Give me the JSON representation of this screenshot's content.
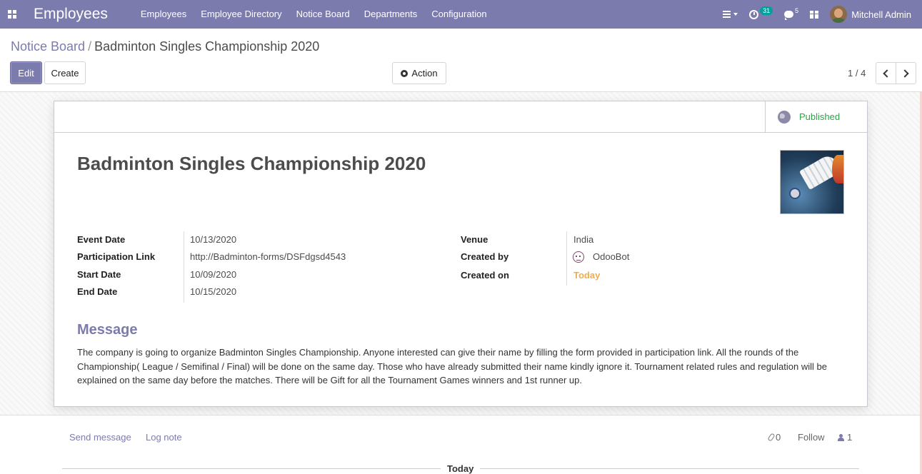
{
  "navbar": {
    "app_title": "Employees",
    "menu": [
      "Employees",
      "Employee Directory",
      "Notice Board",
      "Departments",
      "Configuration"
    ],
    "activity_count": "31",
    "messages_count": "5",
    "user_name": "Mitchell Admin",
    "icons": [
      "apps-icon",
      "hamburger-icon",
      "clock-icon",
      "chat-icon",
      "gift-icon"
    ]
  },
  "breadcrumb": {
    "parent": "Notice Board",
    "separator": "/",
    "current": "Badminton Singles Championship 2020"
  },
  "buttons": {
    "edit": "Edit",
    "create": "Create",
    "action": "Action"
  },
  "pager": {
    "value": "1 / 4"
  },
  "record": {
    "status": "Published",
    "title": "Badminton Singles Championship 2020",
    "left_fields": [
      {
        "label": "Event Date",
        "value": "10/13/2020"
      },
      {
        "label": "Participation Link",
        "value": "http://Badminton-forms/DSFdgsd4543"
      },
      {
        "label": "Start Date",
        "value": "10/09/2020"
      },
      {
        "label": "End Date",
        "value": "10/15/2020"
      }
    ],
    "right_fields": [
      {
        "label": "Venue",
        "value": "India"
      },
      {
        "label": "Created by",
        "value": "OdooBot"
      },
      {
        "label": "Created on",
        "value": "Today"
      }
    ],
    "message_heading": "Message",
    "message_body": "The company is going to organize Badminton Singles Championship. Anyone interested can give their name by filling the form provided in participation link. All the rounds of the Championship( League / Semifinal / Final) will be done on the same day. Those who have already submitted their name kindly ignore it. Tournament related rules and regulation will be explained on the same day before the matches.  There will be Gift for all the Tournament Games winners and 1st runner up."
  },
  "chatter": {
    "send_message": "Send message",
    "log_note": "Log note",
    "attachments": "0",
    "follow": "Follow",
    "followers": "1",
    "date_separator": "Today"
  },
  "colors": {
    "brand": "#7c7bad",
    "published": "#28a745",
    "today": "#f0ad4e",
    "badge": "#00a09d"
  }
}
